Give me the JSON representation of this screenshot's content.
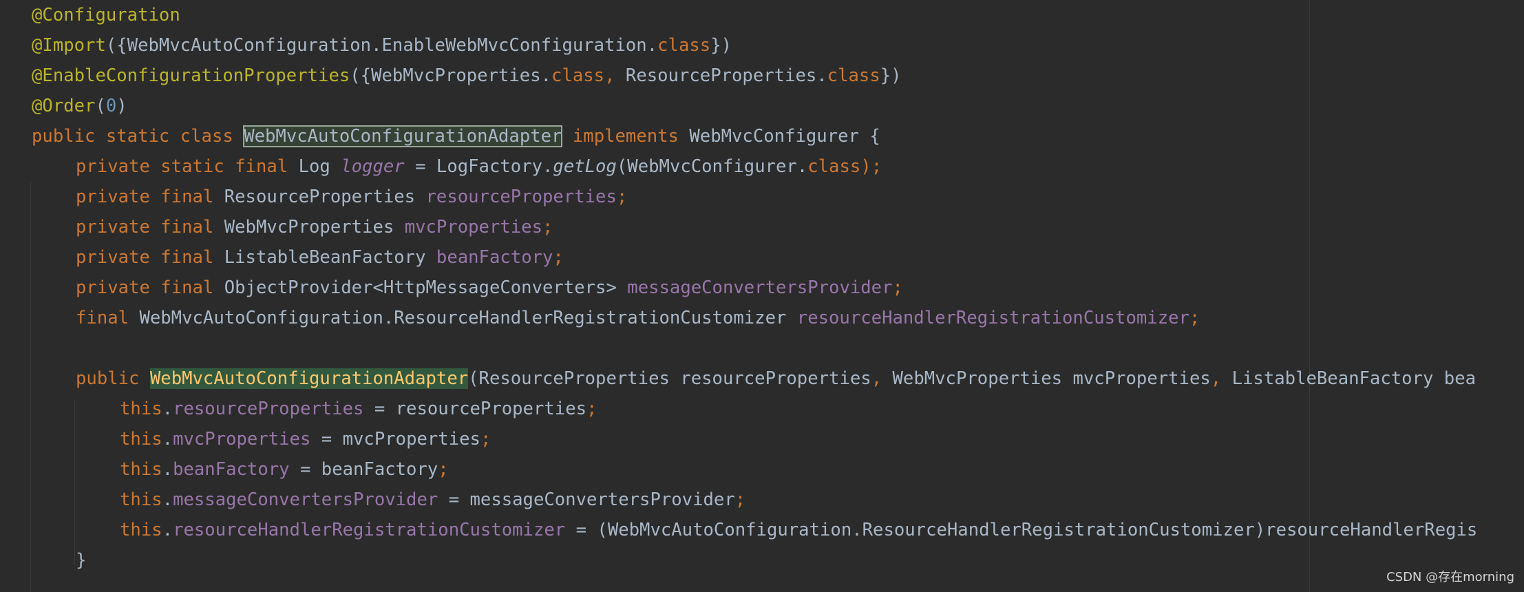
{
  "editor": {
    "lines": [
      {
        "indent": 0,
        "tokens": [
          {
            "t": "@Configuration",
            "c": "ann"
          }
        ]
      },
      {
        "indent": 0,
        "tokens": [
          {
            "t": "@Import",
            "c": "ann"
          },
          {
            "t": "({WebMvcAutoConfiguration.EnableWebMvcConfiguration.",
            "c": "id"
          },
          {
            "t": "class",
            "c": "kw"
          },
          {
            "t": "})",
            "c": "id"
          }
        ]
      },
      {
        "indent": 0,
        "tokens": [
          {
            "t": "@EnableConfigurationProperties",
            "c": "ann"
          },
          {
            "t": "({WebMvcProperties.",
            "c": "id"
          },
          {
            "t": "class, ",
            "c": "kw"
          },
          {
            "t": "ResourceProperties.",
            "c": "id"
          },
          {
            "t": "class",
            "c": "kw"
          },
          {
            "t": "})",
            "c": "id"
          }
        ]
      },
      {
        "indent": 0,
        "tokens": [
          {
            "t": "@Order",
            "c": "ann"
          },
          {
            "t": "(",
            "c": "id"
          },
          {
            "t": "0",
            "c": "num"
          },
          {
            "t": ")",
            "c": "id"
          }
        ]
      },
      {
        "indent": 0,
        "tokens": [
          {
            "t": "public static class ",
            "c": "kw"
          },
          {
            "t": "WebMvcAutoConfigurationAdapter",
            "c": "id",
            "hl": "box"
          },
          {
            "t": " ",
            "c": "id"
          },
          {
            "t": "implements ",
            "c": "kw"
          },
          {
            "t": "WebMvcConfigurer {",
            "c": "id"
          }
        ]
      },
      {
        "indent": 1,
        "tokens": [
          {
            "t": "private static final ",
            "c": "kw"
          },
          {
            "t": "Log ",
            "c": "id"
          },
          {
            "t": "logger",
            "c": "static-fld"
          },
          {
            "t": " = LogFactory.",
            "c": "id"
          },
          {
            "t": "getLog",
            "c": "mth-static"
          },
          {
            "t": "(WebMvcConfigurer.",
            "c": "id"
          },
          {
            "t": "class",
            "c": "kw"
          },
          {
            "t": ");",
            "c": "kw"
          }
        ]
      },
      {
        "indent": 1,
        "tokens": [
          {
            "t": "private final ",
            "c": "kw"
          },
          {
            "t": "ResourceProperties ",
            "c": "id"
          },
          {
            "t": "resourceProperties",
            "c": "fld"
          },
          {
            "t": ";",
            "c": "kw"
          }
        ]
      },
      {
        "indent": 1,
        "tokens": [
          {
            "t": "private final ",
            "c": "kw"
          },
          {
            "t": "WebMvcProperties ",
            "c": "id"
          },
          {
            "t": "mvcProperties",
            "c": "fld"
          },
          {
            "t": ";",
            "c": "kw"
          }
        ]
      },
      {
        "indent": 1,
        "tokens": [
          {
            "t": "private final ",
            "c": "kw"
          },
          {
            "t": "ListableBeanFactory ",
            "c": "id"
          },
          {
            "t": "beanFactory",
            "c": "fld"
          },
          {
            "t": ";",
            "c": "kw"
          }
        ]
      },
      {
        "indent": 1,
        "tokens": [
          {
            "t": "private final ",
            "c": "kw"
          },
          {
            "t": "ObjectProvider<HttpMessageConverters> ",
            "c": "id"
          },
          {
            "t": "messageConvertersProvider",
            "c": "fld"
          },
          {
            "t": ";",
            "c": "kw"
          }
        ]
      },
      {
        "indent": 1,
        "tokens": [
          {
            "t": "final ",
            "c": "kw"
          },
          {
            "t": "WebMvcAutoConfiguration.ResourceHandlerRegistrationCustomizer ",
            "c": "id"
          },
          {
            "t": "resourceHandlerRegistrationCustomizer",
            "c": "fld"
          },
          {
            "t": ";",
            "c": "kw"
          }
        ]
      },
      {
        "indent": 1,
        "tokens": []
      },
      {
        "indent": 1,
        "tokens": [
          {
            "t": "public ",
            "c": "kw"
          },
          {
            "t": "WebMvcAutoConfigurationAdapter",
            "c": "id",
            "hl": "usage"
          },
          {
            "t": "(ResourceProperties resourceProperties",
            "c": "id"
          },
          {
            "t": ", ",
            "c": "kw"
          },
          {
            "t": "WebMvcProperties mvcProperties",
            "c": "id"
          },
          {
            "t": ", ",
            "c": "kw"
          },
          {
            "t": "ListableBeanFactory bea",
            "c": "id"
          }
        ]
      },
      {
        "indent": 2,
        "tokens": [
          {
            "t": "this",
            "c": "kw"
          },
          {
            "t": ".",
            "c": "id"
          },
          {
            "t": "resourceProperties",
            "c": "fld"
          },
          {
            "t": " = resourceProperties",
            "c": "id"
          },
          {
            "t": ";",
            "c": "kw"
          }
        ]
      },
      {
        "indent": 2,
        "tokens": [
          {
            "t": "this",
            "c": "kw"
          },
          {
            "t": ".",
            "c": "id"
          },
          {
            "t": "mvcProperties",
            "c": "fld"
          },
          {
            "t": " = mvcProperties",
            "c": "id"
          },
          {
            "t": ";",
            "c": "kw"
          }
        ]
      },
      {
        "indent": 2,
        "tokens": [
          {
            "t": "this",
            "c": "kw"
          },
          {
            "t": ".",
            "c": "id"
          },
          {
            "t": "beanFactory",
            "c": "fld"
          },
          {
            "t": " = beanFactory",
            "c": "id"
          },
          {
            "t": ";",
            "c": "kw"
          }
        ]
      },
      {
        "indent": 2,
        "tokens": [
          {
            "t": "this",
            "c": "kw"
          },
          {
            "t": ".",
            "c": "id"
          },
          {
            "t": "messageConvertersProvider",
            "c": "fld"
          },
          {
            "t": " = messageConvertersProvider",
            "c": "id"
          },
          {
            "t": ";",
            "c": "kw"
          }
        ]
      },
      {
        "indent": 2,
        "tokens": [
          {
            "t": "this",
            "c": "kw"
          },
          {
            "t": ".",
            "c": "id"
          },
          {
            "t": "resourceHandlerRegistrationCustomizer",
            "c": "fld"
          },
          {
            "t": " = (WebMvcAutoConfiguration.ResourceHandlerRegistrationCustomizer)resourceHandlerRegis",
            "c": "id"
          }
        ]
      },
      {
        "indent": 1,
        "tokens": [
          {
            "t": "}",
            "c": "id"
          }
        ]
      }
    ]
  },
  "watermark": "CSDN @存在morning",
  "colors": {
    "background": "#2b2b2b",
    "annotation": "#bbb529",
    "keyword": "#cc7832",
    "field": "#9876aa",
    "number": "#6897bb",
    "identifier": "#a9b7c6",
    "usage_highlight": "#32593d"
  }
}
